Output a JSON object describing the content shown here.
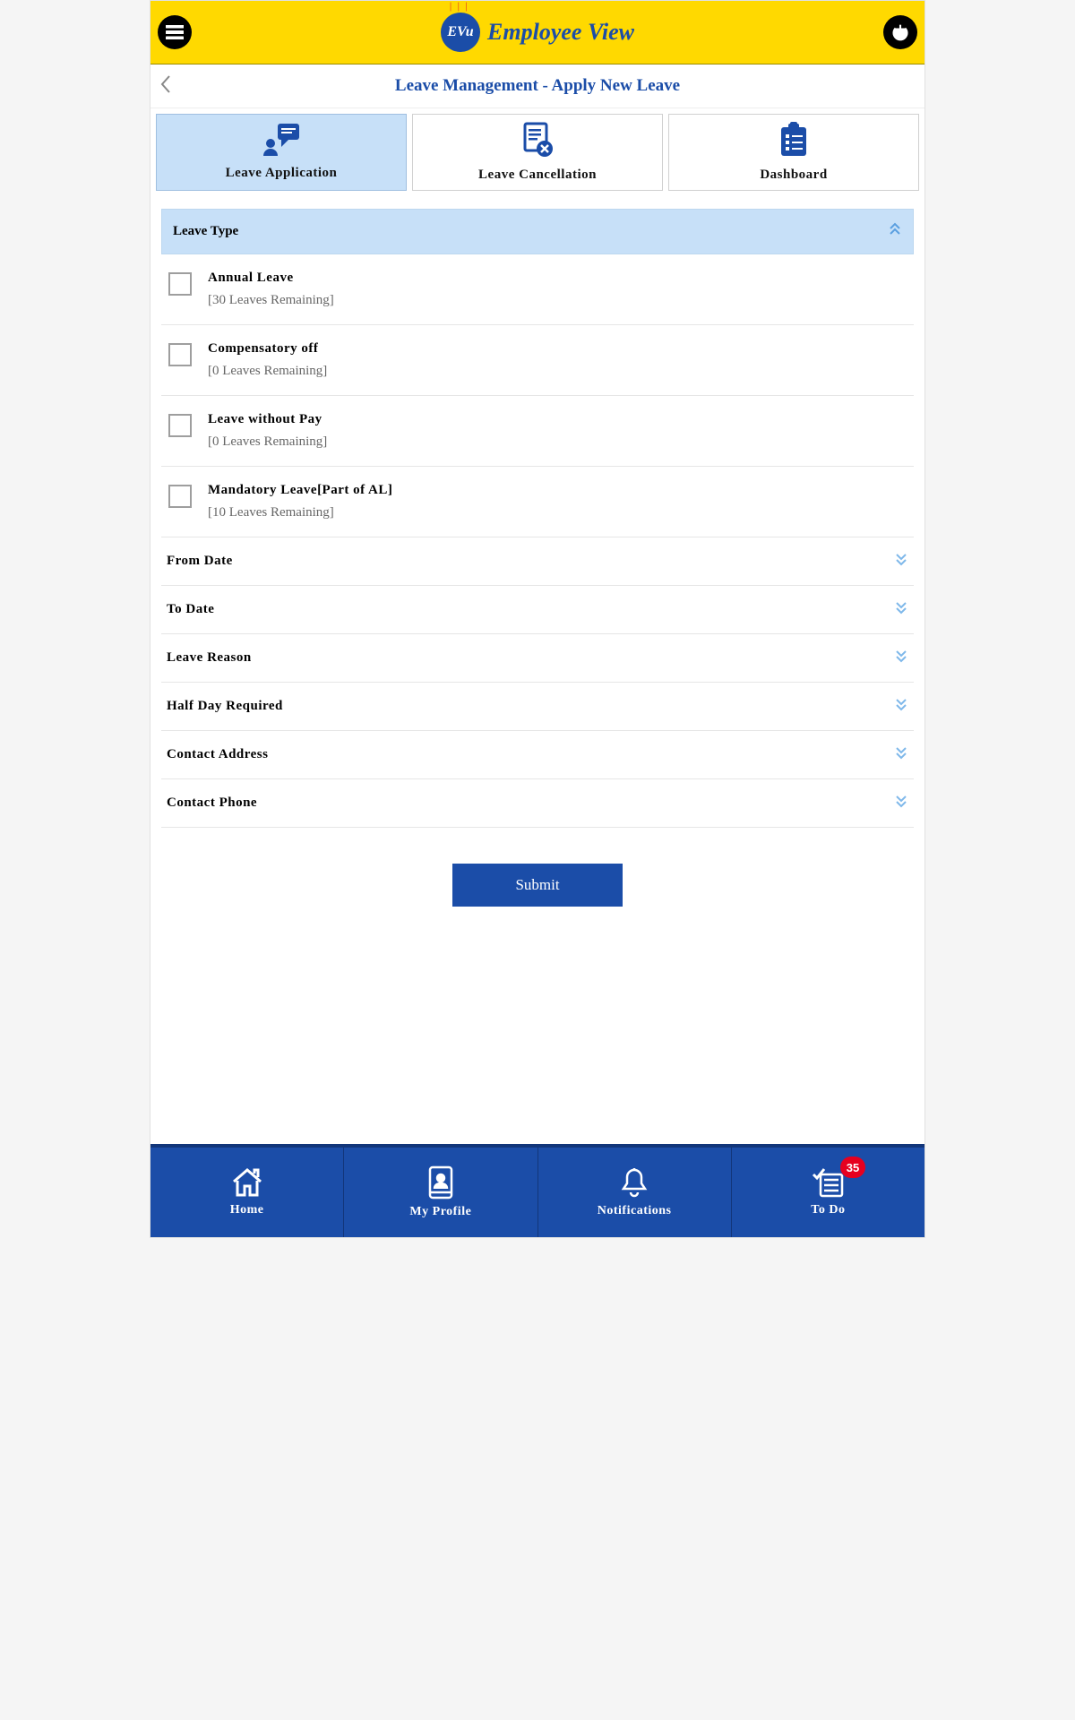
{
  "header": {
    "brand": "Employee View",
    "brand_short": "EVu"
  },
  "page": {
    "title": "Leave Management - Apply New Leave"
  },
  "tabs": [
    {
      "label": "Leave Application",
      "active": true
    },
    {
      "label": "Leave Cancellation",
      "active": false
    },
    {
      "label": "Dashboard",
      "active": false
    }
  ],
  "leave_type_section": {
    "header": "Leave Type",
    "items": [
      {
        "name": "Annual Leave",
        "remaining": "[30 Leaves Remaining]"
      },
      {
        "name": "Compensatory off",
        "remaining": "[0 Leaves Remaining]"
      },
      {
        "name": "Leave without Pay",
        "remaining": "[0 Leaves Remaining]"
      },
      {
        "name": "Mandatory Leave[Part of AL]",
        "remaining": "[10 Leaves Remaining]"
      }
    ]
  },
  "collapsed_sections": [
    "From Date",
    "To Date",
    "Leave Reason",
    "Half Day Required",
    "Contact Address",
    "Contact Phone"
  ],
  "submit_label": "Submit",
  "bottom_nav": {
    "items": [
      {
        "label": "Home"
      },
      {
        "label": "My Profile"
      },
      {
        "label": "Notifications"
      },
      {
        "label": "To Do",
        "badge": "35"
      }
    ]
  }
}
